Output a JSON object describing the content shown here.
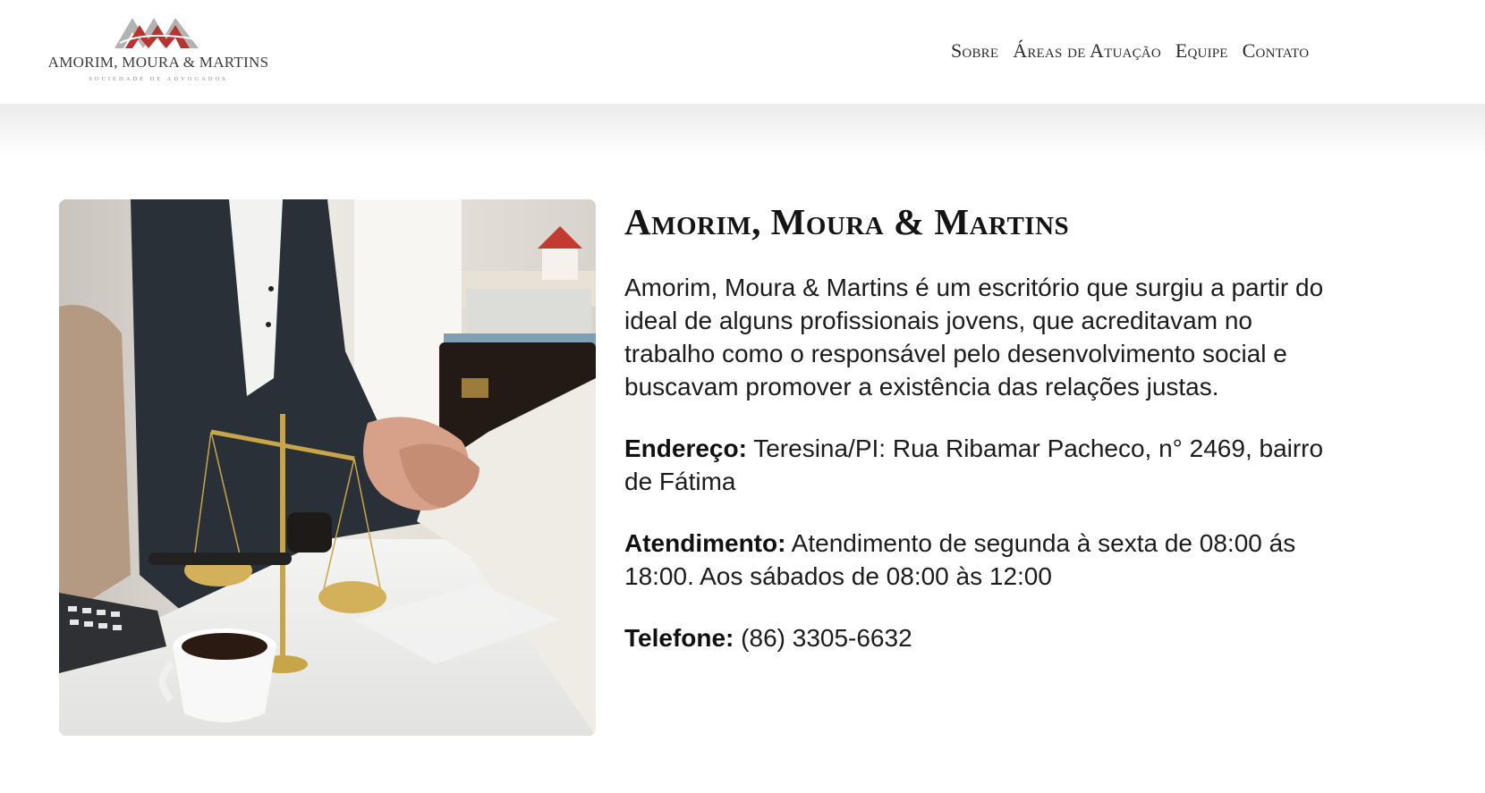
{
  "brand": {
    "name": "Amorim, Moura & Martins",
    "logo_text": "AMORIM, MOURA & MARTINS",
    "logo_subtitle": "SOCIEDADE DE ADVOGADOS"
  },
  "nav": {
    "items": [
      {
        "label": "Sobre"
      },
      {
        "label": "Áreas de Atuação"
      },
      {
        "label": "Equipe"
      },
      {
        "label": "Contato"
      }
    ]
  },
  "about": {
    "title": "Amorim, Moura & Martins",
    "description": "Amorim, Moura & Martins é um escritório que surgiu a partir do ideal de alguns profissionais jovens, que acreditavam no trabalho como o responsável pelo desenvolvimento social e buscavam promover a existência das relações justas.",
    "address_label": "Endereço:",
    "address_value": "Teresina/PI: Rua Ribamar Pacheco, n° 2469, bairro de Fátima",
    "hours_label": "Atendimento:",
    "hours_value": "Atendimento de segunda à sexta de 08:00 ás 18:00. Aos sábados de 08:00 às 12:00",
    "phone_label": "Telefone:",
    "phone_value": "(86) 3305-6632"
  },
  "image": {
    "icon": "handshake-photo"
  },
  "colors": {
    "logo_red": "#b8322f",
    "logo_gray": "#8c8c8c",
    "text": "#1c1c1c"
  }
}
